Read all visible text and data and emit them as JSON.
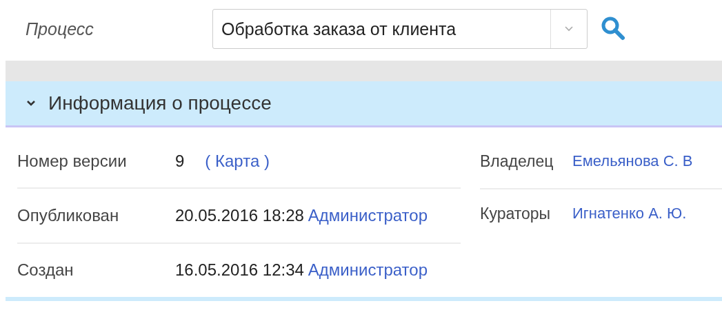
{
  "filter": {
    "label": "Процесс",
    "value": "Обработка заказа от клиента"
  },
  "section": {
    "title": "Информация о процессе",
    "expanded": true
  },
  "left_fields": [
    {
      "label": "Номер версии",
      "value": "9",
      "link": "( Карта )"
    },
    {
      "label": "Опубликован",
      "value": "20.05.2016 18:28",
      "link": "Администратор"
    },
    {
      "label": "Создан",
      "value": "16.05.2016 12:34",
      "link": "Администратор"
    }
  ],
  "right_fields": [
    {
      "label": "Владелец",
      "link": "Емельянова С. В"
    },
    {
      "label": "Кураторы",
      "link": "Игнатенко А. Ю."
    }
  ]
}
